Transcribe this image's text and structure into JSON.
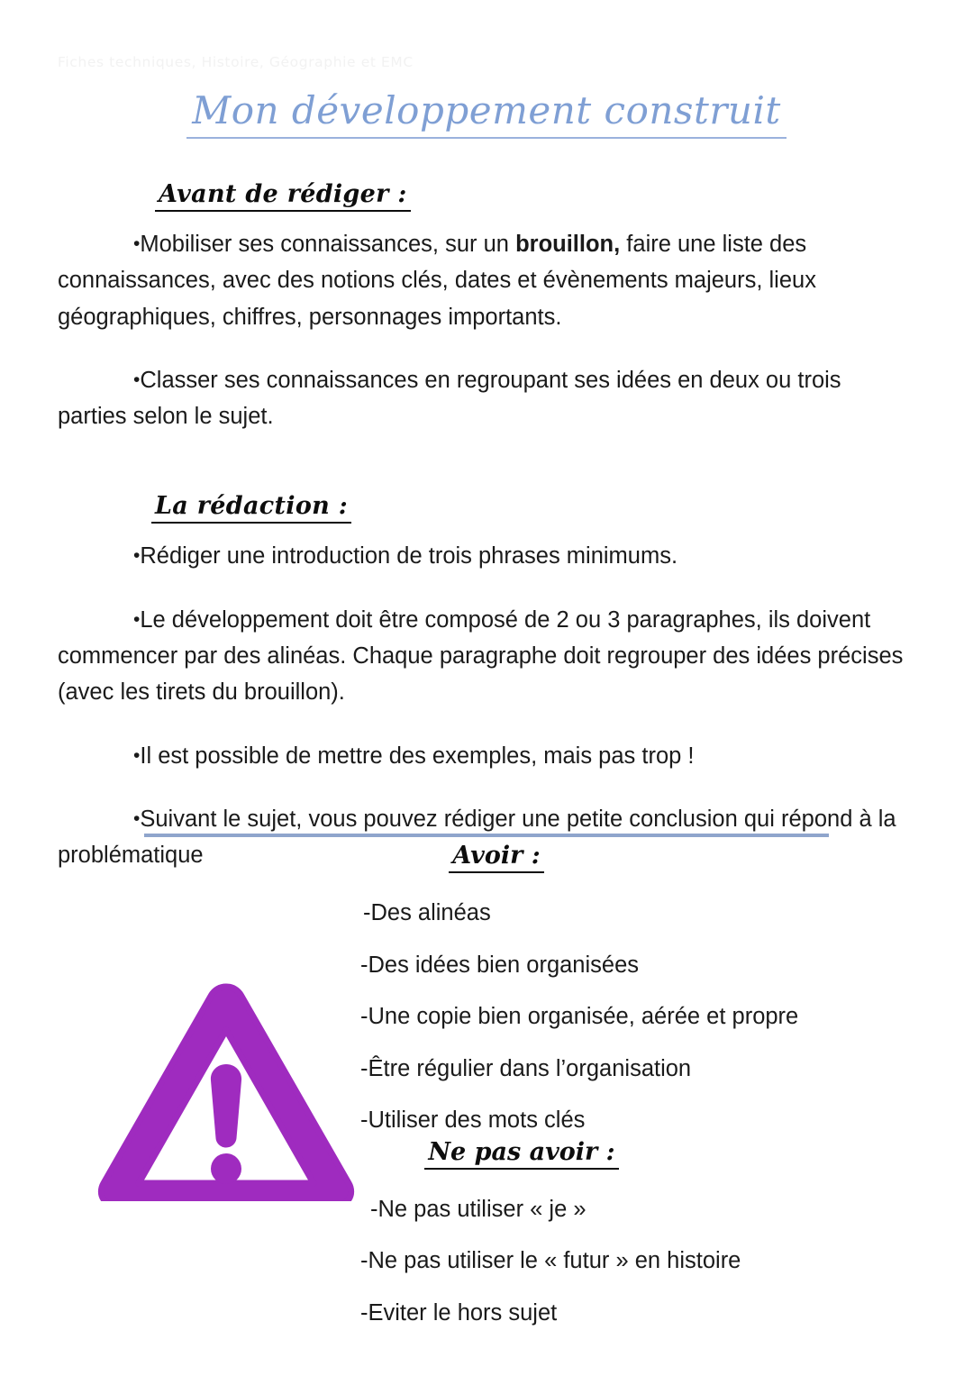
{
  "document": {
    "running_header": "Fiches techniques, Histoire, Géographie et EMC",
    "title": "Mon développement construit"
  },
  "colors": {
    "title_blue": "#7f9fd4",
    "divider_blue": "#8fa5cc",
    "warning_purple": "#9f2bbf",
    "body_text": "#1a1a1a",
    "header_faint": "#f2f2f2"
  },
  "sections": [
    {
      "heading": "Avant de rédiger :",
      "paragraphs": [
        {
          "bullet": "•",
          "parts": [
            {
              "text": "Mobiliser ses connaissances, sur un ",
              "bold": false
            },
            {
              "text": "brouillon,",
              "bold": true
            },
            {
              "text": " faire une liste des connaissances, avec des notions clés, dates et évènements majeurs, lieux géographiques, chiffres, personnages importants.",
              "bold": false
            }
          ]
        },
        {
          "bullet": "•",
          "parts": [
            {
              "text": "Classer ses connaissances en regroupant ses idées en deux ou trois parties selon le sujet.",
              "bold": false
            }
          ]
        }
      ]
    },
    {
      "heading": "La rédaction :",
      "paragraphs": [
        {
          "bullet": "•",
          "parts": [
            {
              "text": "Rédiger une introduction de trois phrases minimums.",
              "bold": false
            }
          ]
        },
        {
          "bullet": "•",
          "parts": [
            {
              "text": "Le développement doit être composé de 2 ou 3 paragraphes, ils doivent commencer par des alinéas. Chaque paragraphe doit regrouper des idées précises (avec les tirets du brouillon).",
              "bold": false
            }
          ]
        },
        {
          "bullet": "•",
          "parts": [
            {
              "text": "Il est possible de mettre des exemples, mais pas trop !",
              "bold": false
            }
          ]
        },
        {
          "bullet": "•",
          "parts": [
            {
              "text": "Suivant le sujet, vous pouvez rédiger une petite conclusion qui répond à la problématique",
              "bold": false
            }
          ]
        }
      ]
    }
  ],
  "checklist": {
    "have": {
      "heading": "Avoir :",
      "items": [
        "-Des alinéas",
        "-Des idées bien organisées",
        "-Une copie bien organisée, aérée et propre",
        "-Être régulier dans l’organisation",
        "-Utiliser des mots clés"
      ]
    },
    "avoid": {
      "heading": "Ne pas avoir :",
      "items": [
        "-Ne pas utiliser « je »",
        "-Ne pas utiliser le « futur » en histoire",
        "-Eviter le hors sujet"
      ]
    },
    "icon": "warning-triangle-icon"
  }
}
